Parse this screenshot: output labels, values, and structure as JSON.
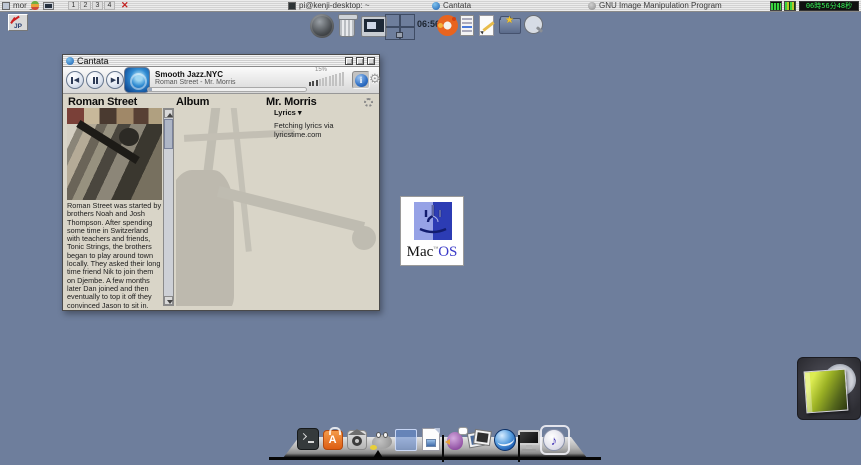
{
  "colors": {
    "desktop": "#6e7e9c",
    "lcd_green": "#35ee55",
    "ubuntu_orange": "#e8641f",
    "accent_blue": "#2f6fc4"
  },
  "menubar": {
    "window_label": "mor",
    "minimize_glyph": "_",
    "workspaces": [
      "1",
      "2",
      "3",
      "4"
    ],
    "close_glyph": "✕",
    "tasks": [
      {
        "icon": "terminal",
        "label": "pi@kenji-desktop: ~"
      },
      {
        "icon": "cantata",
        "label": "Cantata"
      },
      {
        "icon": "gimp",
        "label": "GNU Image Manipulation Program"
      }
    ],
    "clock": "06時56分48秒"
  },
  "applet_row": {
    "clock": "06:56",
    "star_glyph": "★"
  },
  "input_indicator": {
    "label": "JP"
  },
  "player": {
    "window_title": "Cantata",
    "controls": {
      "prev": "◀",
      "next": "▶"
    },
    "track_title": "Smooth Jazz.NYC",
    "track_subtitle": "Roman Street - Mr. Morris",
    "volume_label": "15%",
    "info_glyph": "i",
    "gear_glyph": "⚙",
    "columns": {
      "artist": "Roman Street",
      "album": "Album",
      "track": "Mr. Morris"
    },
    "lyrics_header": "Lyrics ▾",
    "lyrics_status": "Fetching lyrics via lyricstime.com",
    "artist_bio": "Roman Street was started by brothers Noah and Josh Thompson. After spending some time in Switzerland with teachers and friends, Tonic Strings, the brothers began to play around town locally. They asked their long time friend Nik to join them on Djembe. A few months later Dan joined and then eventually to top it off they convinced Jason to sit in. They clicked almost instantly and each member brings a wide variety of influence that somehow has fused together to"
  },
  "macos_badge": {
    "word1": "Mac",
    "tm": "™",
    "word2": "OS"
  },
  "dock": {
    "items": [
      {
        "name": "terminal"
      },
      {
        "name": "software-center",
        "glyph": "A"
      },
      {
        "name": "home-folder"
      },
      {
        "name": "gimp"
      },
      {
        "name": "window-placeholder"
      },
      {
        "name": "libreoffice-writer"
      },
      {
        "name": "pidgin-messenger"
      },
      {
        "name": "photo-manager"
      },
      {
        "name": "web-browser"
      },
      {
        "name": "display-settings"
      },
      {
        "name": "music-player",
        "glyph": "♪"
      }
    ]
  },
  "cd_widget": {
    "name": "cd-album-art"
  }
}
